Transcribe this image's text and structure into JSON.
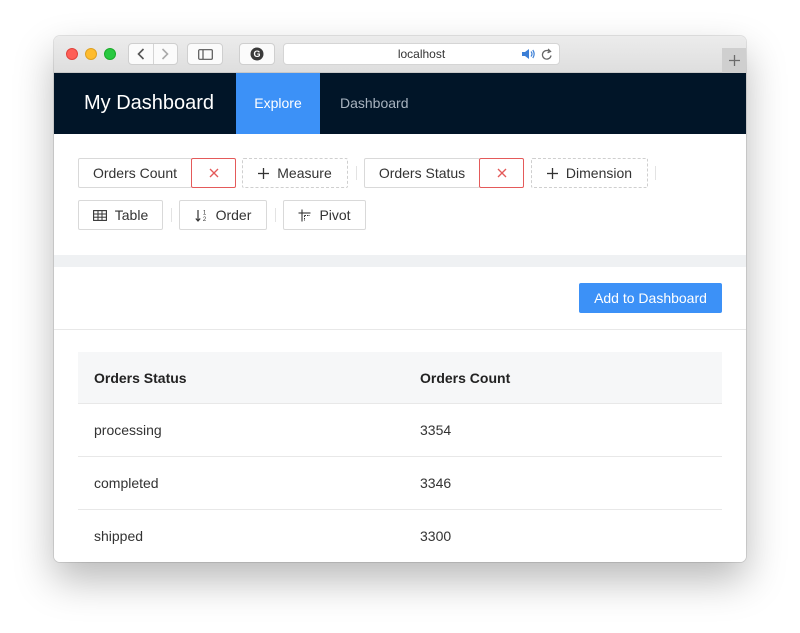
{
  "browser": {
    "url": "localhost"
  },
  "app": {
    "title": "My Dashboard",
    "nav": [
      {
        "label": "Explore",
        "active": true
      },
      {
        "label": "Dashboard",
        "active": false
      }
    ]
  },
  "builder": {
    "measure_chip": "Orders Count",
    "add_measure": "Measure",
    "dimension_chip": "Orders Status",
    "add_dimension": "Dimension",
    "table_button": "Table",
    "order_button": "Order",
    "pivot_button": "Pivot"
  },
  "results": {
    "add_to_dashboard": "Add to Dashboard",
    "columns": [
      "Orders Status",
      "Orders Count"
    ],
    "rows": [
      [
        "processing",
        "3354"
      ],
      [
        "completed",
        "3346"
      ],
      [
        "shipped",
        "3300"
      ]
    ]
  },
  "colors": {
    "header_bg": "#011528",
    "accent": "#3c91f7",
    "remove": "#e45a5a"
  },
  "icons": [
    "back-icon",
    "forward-icon",
    "sidebar-icon",
    "grammarly-icon",
    "speaker-icon",
    "reload-icon",
    "plus-icon",
    "close-icon",
    "table-icon",
    "sort-icon",
    "pivot-icon"
  ]
}
